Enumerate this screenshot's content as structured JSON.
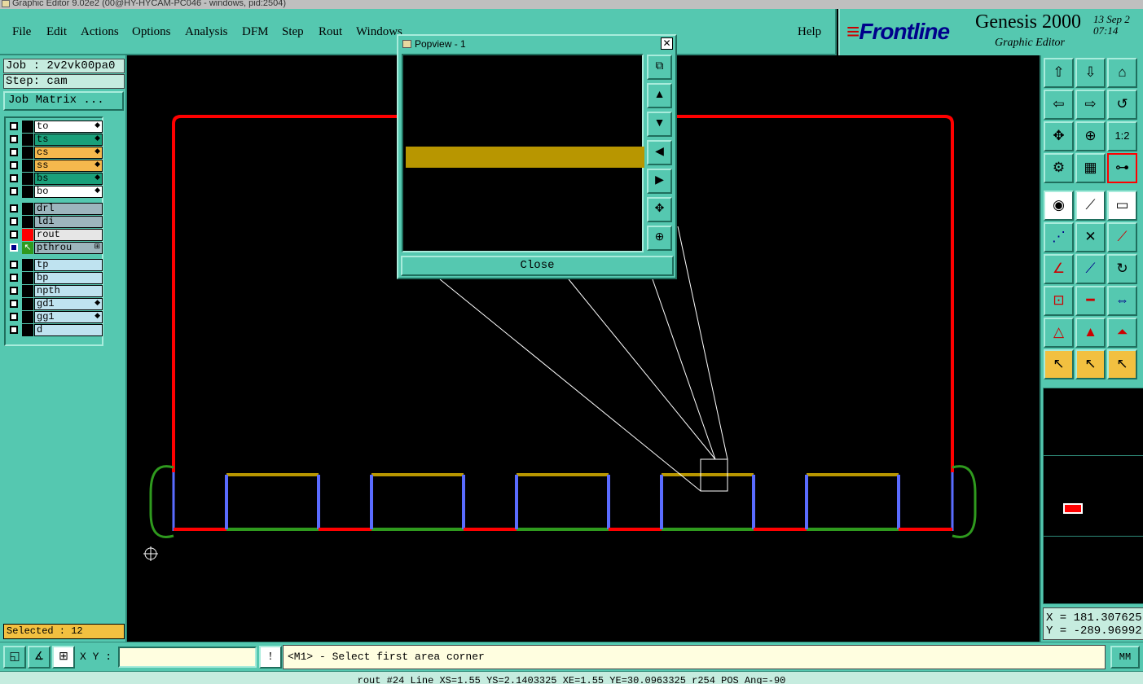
{
  "window": {
    "title": "Graphic Editor 9.02e2 (00@HY-HYCAM-PC046 - windows, pid:2504)"
  },
  "menu": [
    "File",
    "Edit",
    "Actions",
    "Options",
    "Analysis",
    "DFM",
    "Step",
    "Rout",
    "Windows"
  ],
  "help_label": "Help",
  "logo": {
    "brand": "Frontline",
    "product": "Genesis 2000",
    "subtitle": "Graphic Editor",
    "date": "13 Sep 2",
    "time": "07:14"
  },
  "job": {
    "job_text": "Job : 2v2vk00pa0",
    "step_text": "Step: cam",
    "matrix_label": "Job Matrix ..."
  },
  "layers": [
    {
      "name": "to",
      "color": "#ffffff",
      "flag": "◆"
    },
    {
      "name": "ts",
      "color": "#1aa07a",
      "flag": "◆"
    },
    {
      "name": "cs",
      "color": "#f5b84d",
      "flag": "◆"
    },
    {
      "name": "ss",
      "color": "#f5b84d",
      "flag": "◆"
    },
    {
      "name": "bs",
      "color": "#1aa07a",
      "flag": "◆"
    },
    {
      "name": "bo",
      "color": "#ffffff",
      "flag": "◆"
    },
    {
      "name": "drl",
      "color": "#9db5bd",
      "flag": ""
    },
    {
      "name": "ldi",
      "color": "#9db5bd",
      "flag": ""
    },
    {
      "name": "rout",
      "color": "#e6e6e6",
      "flag": ""
    },
    {
      "name": "pthrou",
      "color": "#9db5bd",
      "flag": "⊞"
    },
    {
      "name": "tp",
      "color": "#bfe3f0",
      "flag": ""
    },
    {
      "name": "bp",
      "color": "#bfe3f0",
      "flag": ""
    },
    {
      "name": "npth",
      "color": "#bfe3f0",
      "flag": ""
    },
    {
      "name": "gd1",
      "color": "#bfe3f0",
      "flag": "◆"
    },
    {
      "name": "gg1",
      "color": "#bfe3f0",
      "flag": "◆"
    },
    {
      "name": "d",
      "color": "#bfe3f0",
      "flag": ""
    }
  ],
  "selected_text": "Selected : 12",
  "popview": {
    "title": "Popview - 1",
    "close_label": "Close",
    "close_x": "✕"
  },
  "coords": {
    "x": "X = 181.307625",
    "y": "Y = -289.96992"
  },
  "xy_label": "X Y :",
  "xy_value": "",
  "prompt": "<M1> - Select first area corner",
  "units": "MM",
  "status": "rout #24 Line XS=1.55 YS=2.1403325 XE=1.55 YE=30.0963325 r254 POS Ang=-90",
  "colors": {
    "panel": "#55c8b0",
    "rout": "#ff0000",
    "top": "#b89600",
    "bottom": "#2f9a1e",
    "side": "#5a6cff"
  }
}
